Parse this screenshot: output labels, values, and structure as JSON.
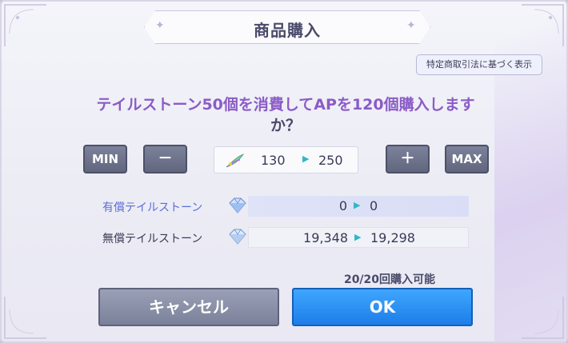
{
  "dialog": {
    "title": "商品購入",
    "legal_button": "特定商取引法に基づく表示",
    "message_line1": "テイルストーン50個を消費してAPを120個購入します",
    "message_line2": "か？"
  },
  "controls": {
    "min_label": "MIN",
    "minus_label": "－",
    "plus_label": "＋",
    "max_label": "MAX",
    "ap_from": "130",
    "ap_to": "250",
    "arrow": "▶"
  },
  "balances": {
    "paid_label": "有償テイルストーン",
    "paid_from": "0",
    "paid_to": "0",
    "free_label": "無償テイルストーン",
    "free_from": "19,348",
    "free_to": "19,298"
  },
  "footer": {
    "available": "20/20回購入可能",
    "cancel_label": "キャンセル",
    "ok_label": "OK"
  },
  "colors": {
    "accent_purple": "#8b5cc7",
    "paid_label_color": "#5a6fd6",
    "ok_blue": "#2a8df5",
    "arrow_cyan": "#2fb7c8"
  },
  "icons": {
    "ap": "feather-ap-icon",
    "paid_stone": "diamond-icon",
    "free_stone": "diamond-icon"
  }
}
